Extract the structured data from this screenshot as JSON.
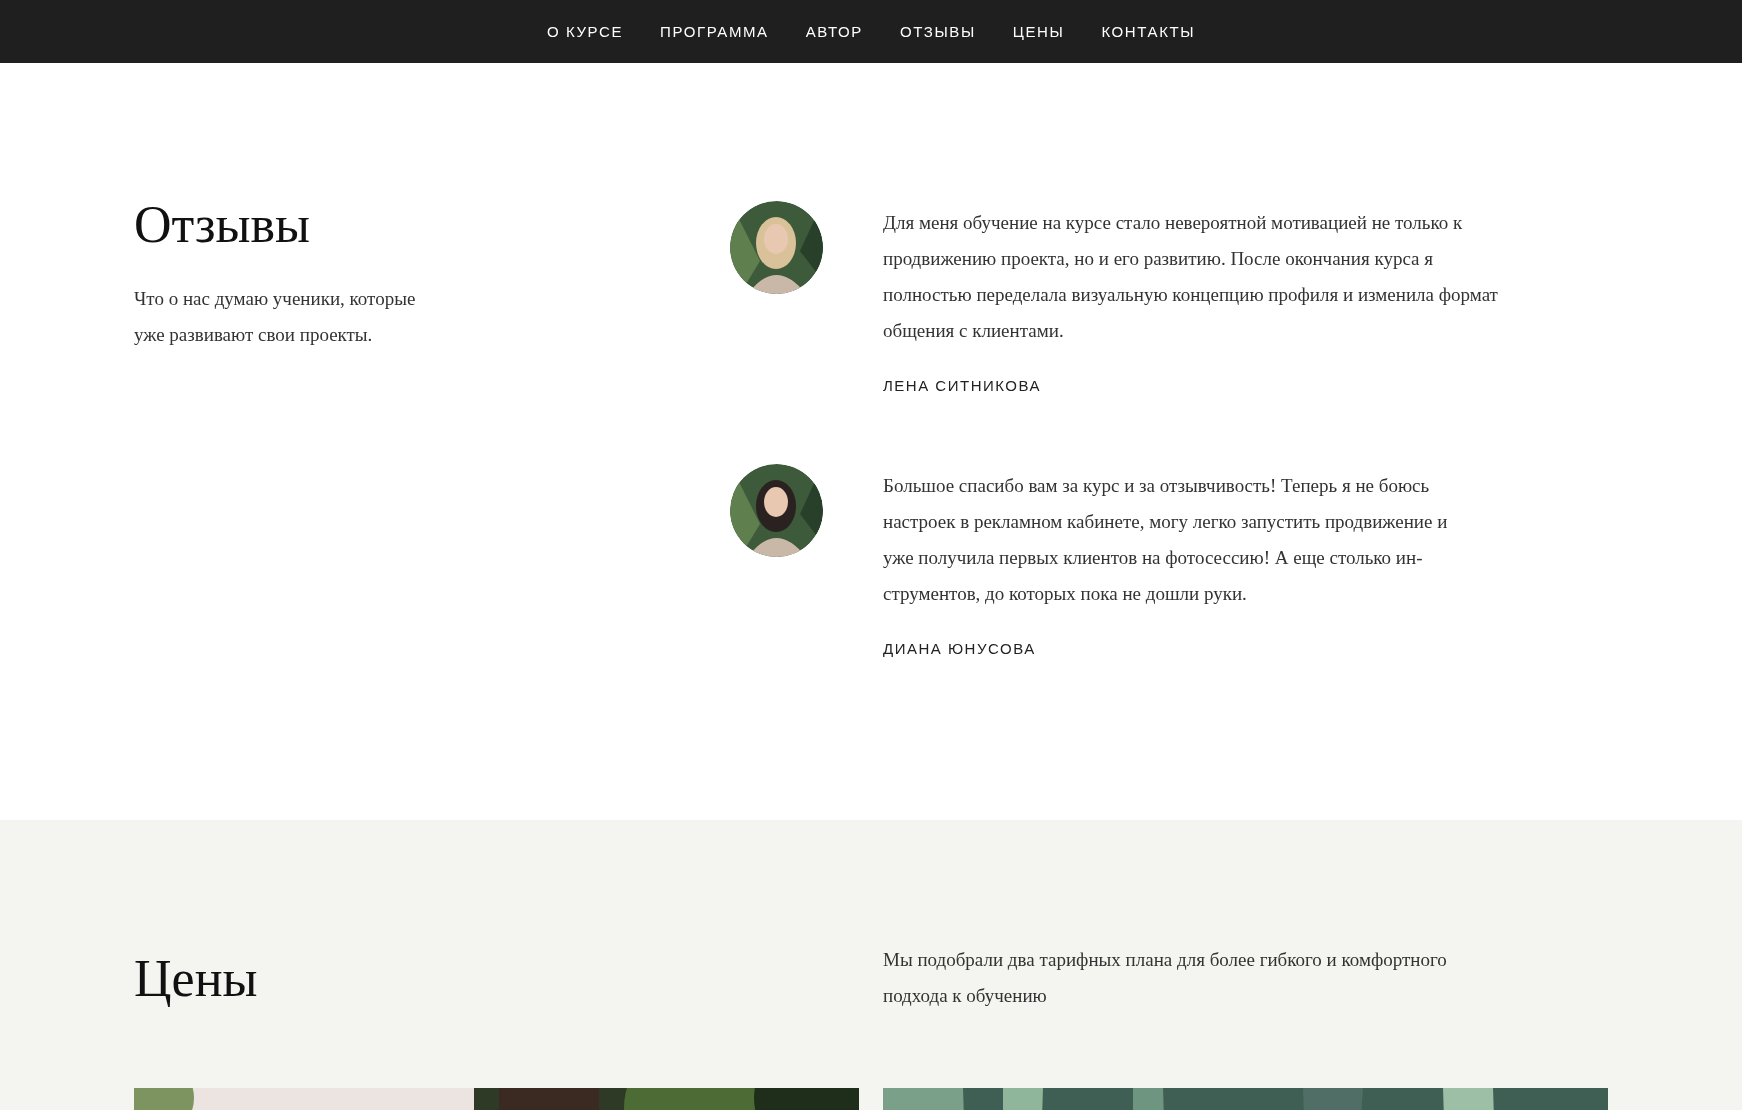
{
  "nav": {
    "items": [
      {
        "label": "О КУРСЕ"
      },
      {
        "label": "ПРОГРАММА"
      },
      {
        "label": "АВТОР"
      },
      {
        "label": "ОТЗЫВЫ"
      },
      {
        "label": "ЦЕНЫ"
      },
      {
        "label": "КОНТАКТЫ"
      }
    ]
  },
  "reviews": {
    "title": "Отзывы",
    "subtitle": "Что о нас думаю ученики, которые\nуже развивают свои проекты.",
    "items": [
      {
        "text": "Для меня обучение на курсе стало невероятной мотивацией не только к\nпродвижению проекта, но и его развитию. После окончания курса я\nполностью переделала визуальную концепцию профиля и изменила формат\nобщения с клиентами.",
        "author": "ЛЕНА СИТНИКОВА"
      },
      {
        "text": "Большое спасибо вам за курс и за отзывчивость! Теперь я не боюсь\nнастроек в рекламном кабинете, могу легко запустить продвижение и\nуже получила первых клиентов на фотосессию! А еще столько ин-\nструментов, до которых пока не дошли руки.",
        "author": "ДИАНА ЮНУСОВА"
      }
    ]
  },
  "prices": {
    "title": "Цены",
    "description": "Мы подобрали два тарифных плана для более гибкого и комфортного\nподхода к обучению"
  }
}
